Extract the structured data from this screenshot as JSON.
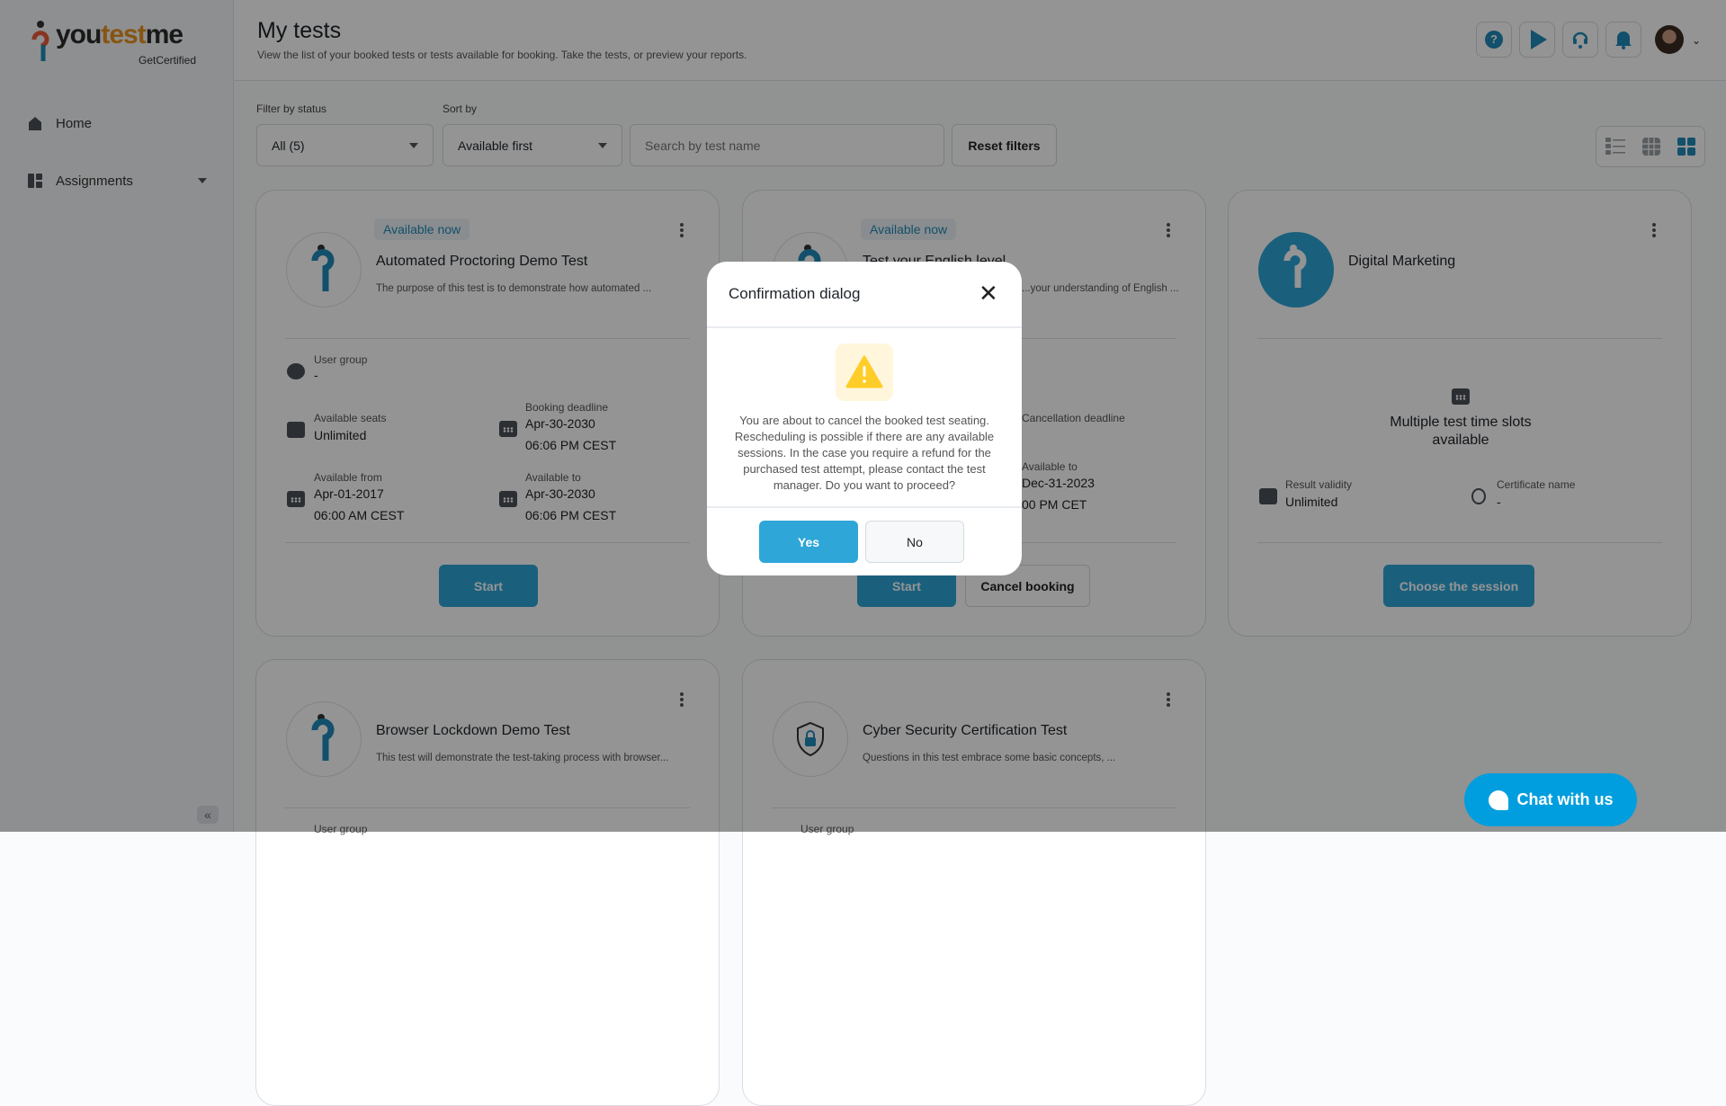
{
  "sidebar": {
    "logo": {
      "text_you": "you",
      "text_test": "test",
      "text_me": "me",
      "sub": "GetCertified"
    },
    "items": [
      {
        "label": "Home",
        "icon": "home-icon"
      },
      {
        "label": "Assignments",
        "icon": "dashboard-icon"
      }
    ],
    "collapse": "«"
  },
  "header": {
    "title": "My tests",
    "subtitle": "View the list of your booked tests or tests available for booking. Take the tests, or preview your reports.",
    "buttons": [
      "help-icon",
      "play-icon",
      "support-headset-icon",
      "bell-icon"
    ]
  },
  "filters": {
    "status_label": "Filter by status",
    "status_value": "All (5)",
    "sort_label": "Sort by",
    "sort_value": "Available first",
    "search_placeholder": "Search by test name",
    "reset": "Reset filters",
    "view_modes": [
      "list",
      "grid-small",
      "grid-large"
    ],
    "active_view": "grid-large"
  },
  "cards": [
    {
      "badge": "Available now",
      "title": "Automated Proctoring Demo Test",
      "desc": "The purpose of this test is to demonstrate how automated ...",
      "user_group_label": "User group",
      "user_group": "-",
      "seats_label": "Available seats",
      "seats": "Unlimited",
      "deadline_label": "Booking deadline",
      "deadline_date": "Apr-30-2030",
      "deadline_time": "06:06 PM CEST",
      "from_label": "Available from",
      "from_date": "Apr-01-2017",
      "from_time": "06:00 AM CEST",
      "to_label": "Available to",
      "to_date": "Apr-30-2030",
      "to_time": "06:06 PM CEST",
      "button": "Start"
    },
    {
      "badge": "Available now",
      "title": "Test your English level",
      "desc": "...your understanding of English ...",
      "cancel_label": "Cancellation deadline",
      "to_label": "Available to",
      "to_date": "Dec-31-2023",
      "to_time": "00 PM CET",
      "button": "Start",
      "button2": "Cancel booking"
    },
    {
      "title": "Digital Marketing",
      "slots": "Multiple test time slots available",
      "validity_label": "Result validity",
      "validity": "Unlimited",
      "cert_label": "Certificate name",
      "cert": "-",
      "button": "Choose the session"
    },
    {
      "title": "Browser Lockdown Demo Test",
      "desc": "This test will demonstrate the test-taking process with browser...",
      "user_group_label": "User group"
    },
    {
      "title": "Cyber Security Certification Test",
      "desc": "Questions in this test embrace some basic concepts, ...",
      "user_group_label": "User group"
    }
  ],
  "dialog": {
    "title": "Confirmation dialog",
    "message": "You are about to cancel the booked test seating. Rescheduling is possible if there are any available sessions. In the case you require a refund for the purchased test attempt, please contact the test manager. Do you want to proceed?",
    "yes": "Yes",
    "no": "No"
  },
  "chat": {
    "label": "Chat with us"
  },
  "colors": {
    "primary": "#2ea6d8",
    "brand": "#1f8ab8",
    "chat": "#009ede",
    "warning": "#ffcd29"
  }
}
